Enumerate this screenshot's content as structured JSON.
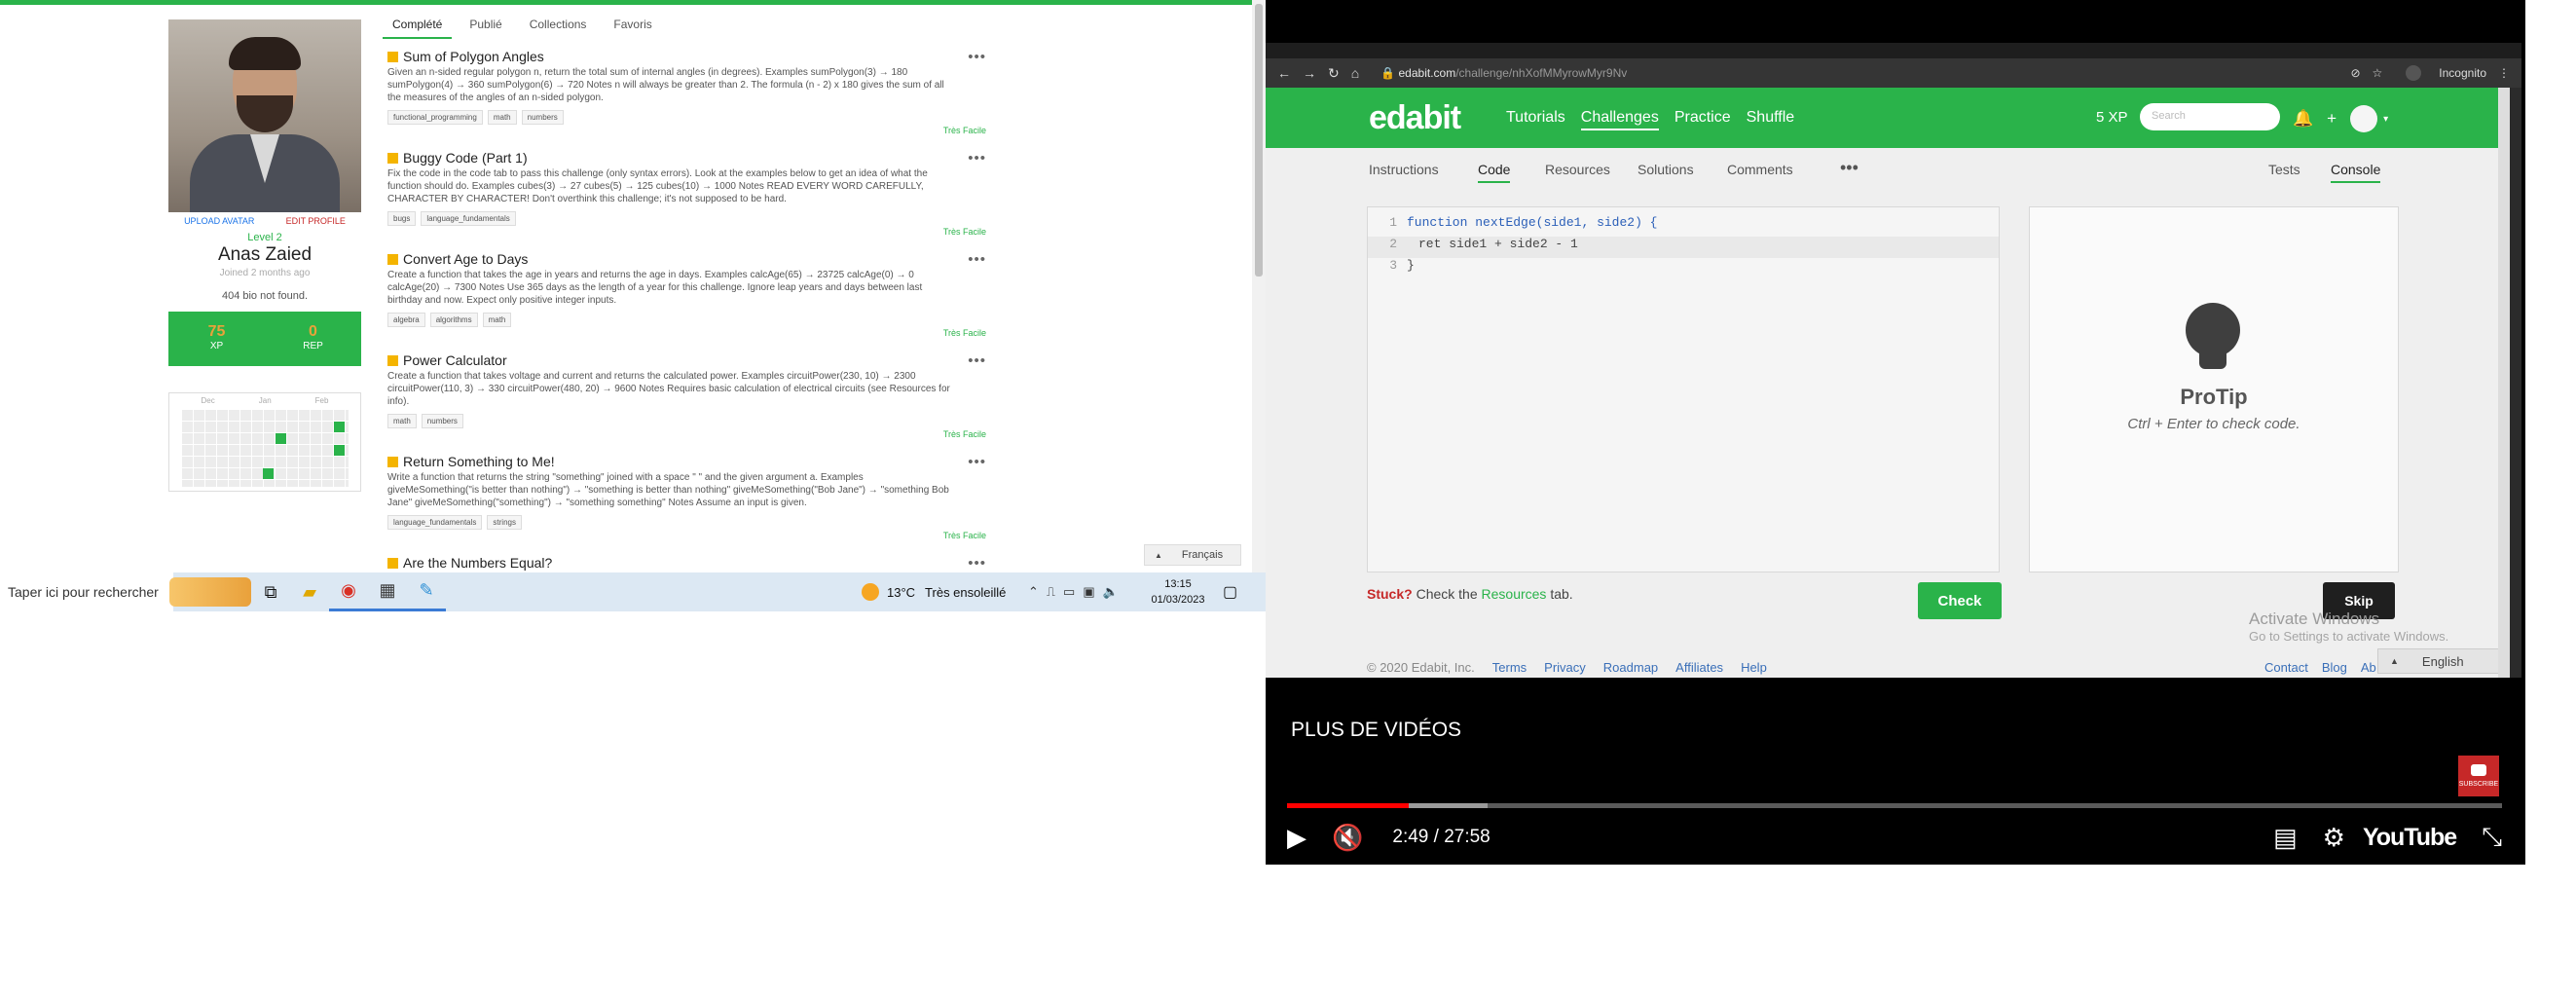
{
  "profile": {
    "upload_avatar": "UPLOAD AVATAR",
    "edit_profile": "EDIT PROFILE",
    "level": "Level 2",
    "name": "Anas Zaied",
    "joined": "Joined 2 months ago",
    "bio": "404 bio not found.",
    "xp_value": "75",
    "xp_label": "XP",
    "rep_value": "0",
    "rep_label": "REP",
    "calendar_months": [
      "Dec",
      "Jan",
      "Feb"
    ]
  },
  "tabs": [
    "Complété",
    "Publié",
    "Collections",
    "Favoris"
  ],
  "challenges": [
    {
      "title": "Sum of Polygon Angles",
      "desc": "Given an n-sided regular polygon n, return the total sum of internal angles (in degrees). Examples sumPolygon(3) → 180 sumPolygon(4) → 360 sumPolygon(6) → 720 Notes n will always be greater than 2. The formula (n - 2) x 180 gives the sum of all the measures of the angles of an n-sided polygon.",
      "tags": [
        "functional_programming",
        "math",
        "numbers"
      ],
      "difficulty": "Très Facile"
    },
    {
      "title": "Buggy Code (Part 1)",
      "desc": "Fix the code in the code tab to pass this challenge (only syntax errors). Look at the examples below to get an idea of what the function should do. Examples cubes(3) → 27 cubes(5) → 125 cubes(10) → 1000 Notes READ EVERY WORD CAREFULLY, CHARACTER BY CHARACTER! Don't overthink this challenge; it's not supposed to be hard.",
      "tags": [
        "bugs",
        "language_fundamentals"
      ],
      "difficulty": "Très Facile"
    },
    {
      "title": "Convert Age to Days",
      "desc": "Create a function that takes the age in years and returns the age in days. Examples calcAge(65) → 23725 calcAge(0) → 0 calcAge(20) → 7300 Notes Use 365 days as the length of a year for this challenge. Ignore leap years and days between last birthday and now. Expect only positive integer inputs.",
      "tags": [
        "algebra",
        "algorithms",
        "math"
      ],
      "difficulty": "Très Facile"
    },
    {
      "title": "Power Calculator",
      "desc": "Create a function that takes voltage and current and returns the calculated power. Examples circuitPower(230, 10) → 2300 circuitPower(110, 3) → 330 circuitPower(480, 20) → 9600 Notes Requires basic calculation of electrical circuits (see Resources for info).",
      "tags": [
        "math",
        "numbers"
      ],
      "difficulty": "Très Facile"
    },
    {
      "title": "Return Something to Me!",
      "desc": "Write a function that returns the string \"something\" joined with a space \" \" and the given argument a. Examples giveMeSomething(\"is better than nothing\") → \"something is better than nothing\" giveMeSomething(\"Bob Jane\") → \"something Bob Jane\" giveMeSomething(\"something\") → \"something something\" Notes Assume an input is given.",
      "tags": [
        "language_fundamentals",
        "strings"
      ],
      "difficulty": "Très Facile"
    },
    {
      "title": "Are the Numbers Equal?",
      "desc": "",
      "tags": [],
      "difficulty": ""
    }
  ],
  "language_button": "Français",
  "taskbar": {
    "search_placeholder": "Taper ici pour rechercher",
    "weather_temp": "13°C",
    "weather_desc": "Très ensoleillé",
    "time": "13:15",
    "date": "01/03/2023"
  },
  "browser": {
    "url_host": "edabit.com",
    "url_path": "/challenge/nhXofMMyrowMyr9Nv",
    "incognito": "Incognito"
  },
  "edabit": {
    "logo": "edabit",
    "nav": [
      "Tutorials",
      "Challenges",
      "Practice",
      "Shuffle"
    ],
    "xp": "5 XP",
    "search_placeholder": "Search",
    "subnav": [
      "Instructions",
      "Code",
      "Resources",
      "Solutions",
      "Comments",
      "Tests",
      "Console"
    ],
    "code_line1_kw": "function",
    "code_line1_fn": "nextEdge",
    "code_line1_rest": "(side1, side2) {",
    "code_line2": "ret side1 + side2 - 1",
    "code_line3": "}",
    "protip_title": "ProTip",
    "protip_sub": "Ctrl + Enter to check code.",
    "stuck": "Stuck?",
    "stuck_mid": "Check the",
    "stuck_link": "Resources",
    "stuck_end": "tab.",
    "check": "Check",
    "skip": "Skip",
    "activate_title": "Activate Windows",
    "activate_sub": "Go to Settings to activate Windows.",
    "footer_copy": "© 2020 Edabit, Inc.",
    "footer_links": [
      "Terms",
      "Privacy",
      "Roadmap",
      "Affiliates",
      "Help"
    ],
    "footer_right": [
      "Contact",
      "Blog",
      "Ab"
    ],
    "language": "English"
  },
  "youtube": {
    "more_videos": "PLUS DE VIDÉOS",
    "subscribe": "SUBSCRIBE",
    "time": "2:49 / 27:58",
    "logo": "YouTube",
    "played_fraction": 0.1,
    "buffered_fraction": 0.165
  },
  "colors": {
    "edabit_green": "#2ab34a",
    "youtube_red": "#ff0000",
    "difficulty_green": "#2ab34a"
  }
}
